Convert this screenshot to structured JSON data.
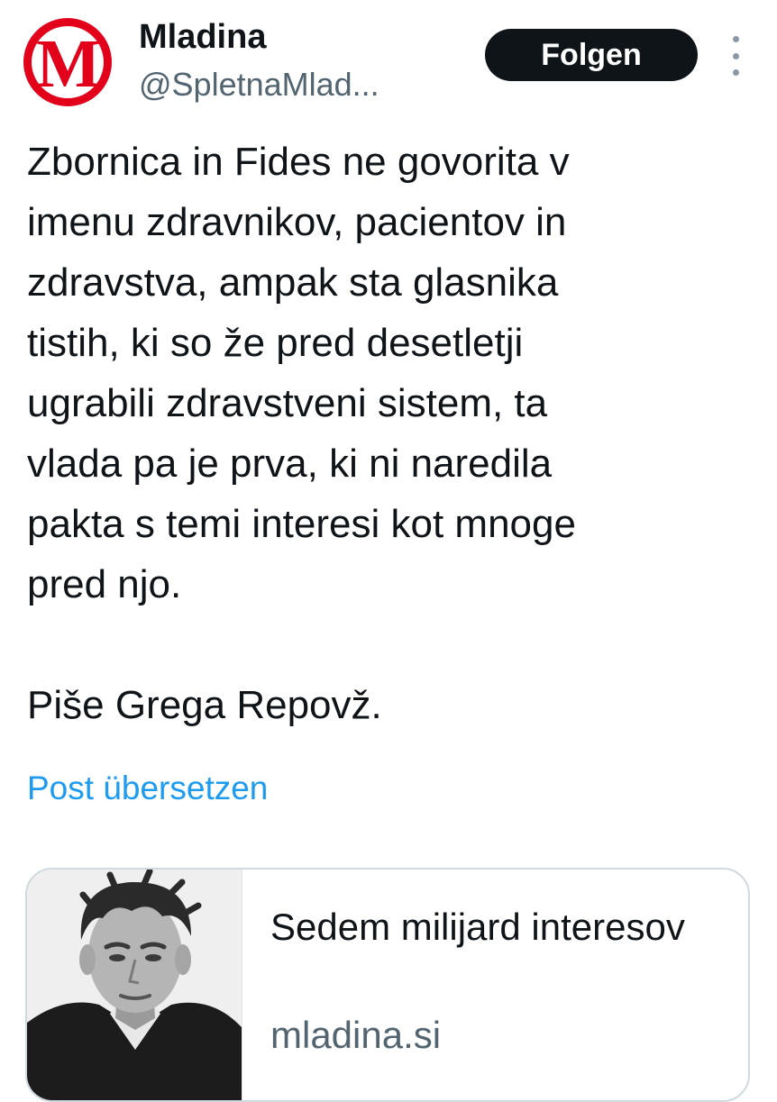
{
  "account": {
    "avatar_letter": "M",
    "display_name": "Mladina",
    "handle": "@SpletnaMlad..."
  },
  "actions": {
    "follow_label": "Folgen"
  },
  "tweet": {
    "text": "Zbornica in Fides ne govorita v\nimenu zdravnikov, pacientov in\nzdravstva, ampak sta glasnika\ntistih, ki so že pred desetletji\nugrabili zdravstveni sistem, ta\nvlada pa je prva, ki ni naredila\npakta s temi interesi kot mnoge\npred njo.\n\nPiše Grega Repovž.",
    "translate_label": "Post übersetzen"
  },
  "link_card": {
    "title": "Sedem milijard interesov",
    "domain": "mladina.si"
  },
  "colors": {
    "brand_red": "#e2001a",
    "link_blue": "#1d9bf0",
    "text_primary": "#0f1419",
    "text_secondary": "#536471"
  }
}
